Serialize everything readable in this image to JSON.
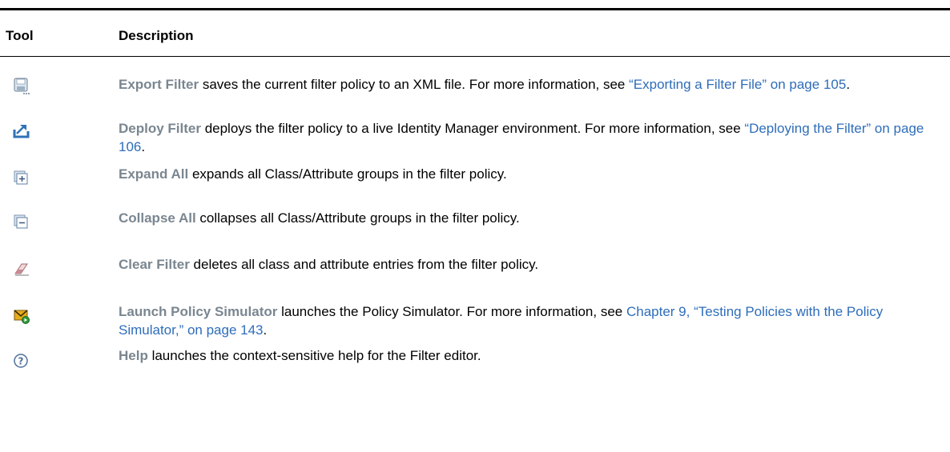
{
  "table": {
    "headers": {
      "tool": "Tool",
      "description": "Description"
    },
    "rows": [
      {
        "icon": "save-filter-icon",
        "term": "Export Filter",
        "text": " saves the current filter policy to an XML file. For more information, see ",
        "link": "“Exporting a Filter File” on page 105",
        "after": "."
      },
      {
        "icon": "deploy-icon",
        "term": "Deploy Filter",
        "text": " deploys the filter policy to a live Identity Manager environment. For more information, see ",
        "link": "“Deploying the Filter” on page 106",
        "after": "."
      },
      {
        "icon": "expand-all-icon",
        "term": "Expand All",
        "text": " expands all Class/Attribute groups in the filter policy.",
        "link": "",
        "after": ""
      },
      {
        "icon": "collapse-all-icon",
        "term": "Collapse All",
        "text": " collapses all Class/Attribute groups in the filter policy.",
        "link": "",
        "after": ""
      },
      {
        "icon": "eraser-icon",
        "term": "Clear Filter",
        "text": " deletes all class and attribute entries from the filter policy.",
        "link": "",
        "after": ""
      },
      {
        "icon": "policy-simulator-icon",
        "term": "Launch Policy Simulator",
        "text": " launches the Policy Simulator. For more information, see ",
        "link": "Chapter 9, “Testing Policies with the Policy Simulator,” on page 143",
        "after": "."
      },
      {
        "icon": "help-icon",
        "term": "Help",
        "text": " launches the context-sensitive help for the Filter editor.",
        "link": "",
        "after": ""
      }
    ]
  }
}
